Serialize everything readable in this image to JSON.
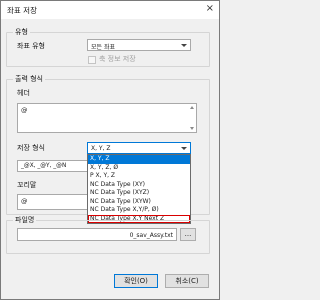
{
  "window": {
    "title": "좌표 저장",
    "close_glyph": "×"
  },
  "type_group": {
    "legend": "유형",
    "coord_type_label": "좌표 유형",
    "coord_type_value": "모든 좌표",
    "checkbox_label": "축 정보 저장"
  },
  "output_group": {
    "legend": "출력 형식",
    "header_label": "헤더",
    "header_value": "@",
    "format_label": "저장 형식",
    "format_value": "X, Y, Z",
    "pattern_value": "_@X, _@Y, _@N",
    "footer_label": "꼬리말",
    "footer_value": "@",
    "options": [
      "X, Y, Z",
      "X, Y, Z, Ø",
      "P X, Y, Z",
      "NC Data Type (XY)",
      "NC Data Type (XYZ)",
      "NC Data Type (XYW)",
      "NC Data Type X,Y/P, Ø)",
      "NC Data Type X,Y Next Z"
    ],
    "selected_index": 0,
    "highlighted_index": 7
  },
  "file_group": {
    "legend": "파일명",
    "filename_value": "0_sav_Assy.txt",
    "browse_label": "..."
  },
  "buttons": {
    "ok": "확인(O)",
    "cancel": "취소(C)"
  }
}
